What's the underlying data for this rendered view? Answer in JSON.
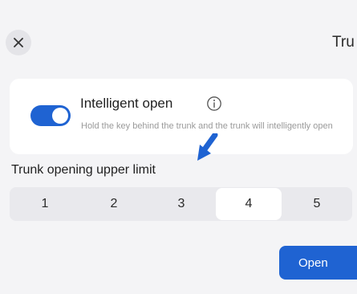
{
  "header": {
    "title": "Tru"
  },
  "option": {
    "title": "Intelligent open",
    "description": "Hold the key behind the trunk and the trunk will intelligently open",
    "toggle_on": true
  },
  "limit": {
    "label": "Trunk opening upper limit",
    "options": [
      "1",
      "2",
      "3",
      "4",
      "5"
    ],
    "selected": "4"
  },
  "footer": {
    "open_label": "Open"
  },
  "colors": {
    "accent": "#1f63d2",
    "background": "#f4f4f6",
    "card": "#ffffff",
    "segment_track": "#e9e9ed"
  },
  "icons": {
    "close": "close-icon",
    "info": "info-icon",
    "annotation": "arrow-icon"
  }
}
